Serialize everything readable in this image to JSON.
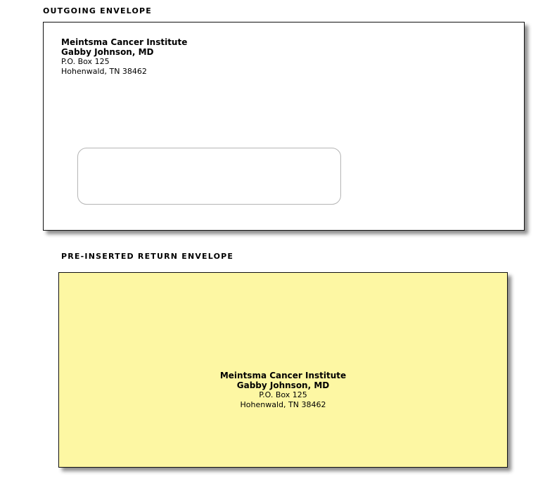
{
  "outgoing": {
    "title": "OUTGOING ENVELOPE",
    "return_address": {
      "organization": "Meintsma Cancer Institute",
      "name": "Gabby Johnson, MD",
      "street": "P.O. Box 125",
      "city_state_zip": "Hohenwald, TN 38462"
    },
    "background_color": "#ffffff"
  },
  "return_envelope": {
    "title": "PRE-INSERTED RETURN ENVELOPE",
    "address": {
      "organization": "Meintsma Cancer Institute",
      "name": "Gabby Johnson, MD",
      "street": "P.O. Box 125",
      "city_state_zip": "Hohenwald, TN 38462"
    },
    "background_color": "#fdf7a3"
  }
}
